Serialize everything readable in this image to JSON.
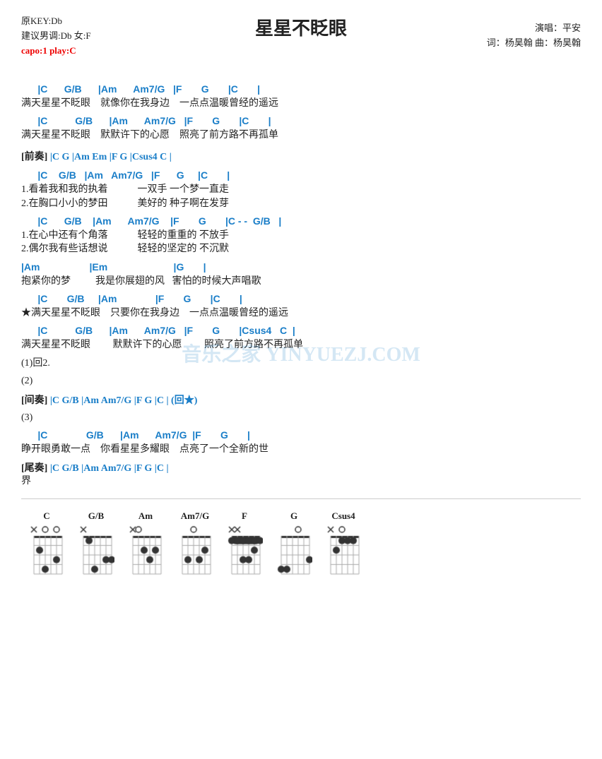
{
  "title": "星星不眨眼",
  "meta": {
    "key": "原KEY:Db",
    "suggest": "建议男调:Db 女:F",
    "capo": "capo:1 play:C",
    "performer": "演唱：平安",
    "lyricist": "词：杨昊翰  曲：杨昊翰"
  },
  "sections": [
    {
      "id": "intro-chords-1",
      "type": "chord",
      "text": "      |C      G/B      |Am      Am7/G   |F       G       |C       |"
    },
    {
      "id": "intro-lyric-1",
      "type": "lyric",
      "text": "满天星星不眨眼    就像你在我身边    一点点温暖曾经的遥远"
    },
    {
      "id": "intro-chords-2",
      "type": "chord",
      "text": "      |C          G/B      |Am      Am7/G   |F       G       |C       |"
    },
    {
      "id": "intro-lyric-2",
      "type": "lyric",
      "text": "满天星星不眨眼    默默许下的心愿    照亮了前方路不再孤单"
    },
    {
      "id": "prelude-label",
      "type": "label",
      "text": "[前奏] |C  G  |Am  Em  |F  G  |Csus4  C  |"
    },
    {
      "id": "verse-chords-1",
      "type": "chord",
      "text": "      |C    G/B   |Am   Am7/G   |F      G     |C       |"
    },
    {
      "id": "verse-lyric-1a",
      "type": "lyric",
      "text": "1.看着我和我的执着            一双手 一个梦一直走"
    },
    {
      "id": "verse-lyric-1b",
      "type": "lyric",
      "text": "2.在胸口小小的梦田            美好的 种子啊在发芽"
    },
    {
      "id": "verse-chords-2",
      "type": "chord",
      "text": "      |C      G/B    |Am      Am7/G    |F       G       |C - -  G/B   |"
    },
    {
      "id": "verse-lyric-2a",
      "type": "lyric",
      "text": "1.在心中还有个角落            轻轻的重重的 不放手"
    },
    {
      "id": "verse-lyric-2b",
      "type": "lyric",
      "text": "2.偶尔我有些话想说            轻轻的坚定的 不沉默"
    },
    {
      "id": "am-chords",
      "type": "chord",
      "text": "|Am                  |Em                        |G       |"
    },
    {
      "id": "am-lyric",
      "type": "lyric",
      "text": "抱紧你的梦          我是你展翅的风   害怕的时候大声唱歌"
    },
    {
      "id": "chorus-chords-1",
      "type": "chord",
      "text": "      |C       G/B     |Am              |F       G       |C       |"
    },
    {
      "id": "chorus-lyric-1",
      "type": "lyric",
      "text": "★满天星星不眨眼    只要你在我身边    一点点温暖曾经的遥远"
    },
    {
      "id": "chorus-chords-2",
      "type": "chord",
      "text": "      |C          G/B      |Am      Am7/G   |F       G       |Csus4   C  |"
    },
    {
      "id": "chorus-lyric-2",
      "type": "lyric",
      "text": "满天星星不眨眼         默默许下的心愿         照亮了前方路不再孤单"
    },
    {
      "id": "repeat-1",
      "type": "lyric",
      "text": "(1)回2."
    },
    {
      "id": "repeat-2",
      "type": "lyric",
      "text": "(2)"
    },
    {
      "id": "interlude-label",
      "type": "label",
      "text": "[间奏] |C  G/B  |Am  Am7/G  |F  G  |C  |   (回★)"
    },
    {
      "id": "repeat-3",
      "type": "lyric",
      "text": "(3)"
    },
    {
      "id": "bridge-chords",
      "type": "chord",
      "text": "      |C              G/B      |Am      Am7/G  |F       G       |"
    },
    {
      "id": "bridge-lyric",
      "type": "lyric",
      "text": "睁开眼勇敢一点    你看星星多耀眼    点亮了一个全新的世"
    },
    {
      "id": "outro-label",
      "type": "label",
      "text": "[尾奏] |C  G/B  |Am  Am7/G  |F  G  |C  |"
    },
    {
      "id": "outro-lyric",
      "type": "lyric",
      "text": "界"
    }
  ],
  "chords": [
    {
      "name": "C",
      "open": [
        "x",
        "",
        "o",
        "",
        "o",
        ""
      ],
      "frets": [
        [
          0,
          0,
          0,
          0,
          0,
          0
        ],
        [
          0,
          0,
          1,
          0,
          0,
          0
        ],
        [
          0,
          1,
          0,
          0,
          0,
          0
        ],
        [
          0,
          0,
          0,
          0,
          1,
          0
        ]
      ],
      "barre": null
    },
    {
      "name": "G/B",
      "open": [
        "x",
        "",
        "",
        "",
        "",
        ""
      ],
      "frets": [
        [
          0,
          0,
          0,
          0,
          0,
          0
        ],
        [
          0,
          1,
          0,
          0,
          0,
          0
        ],
        [
          0,
          0,
          0,
          0,
          1,
          1
        ],
        [
          0,
          0,
          1,
          0,
          0,
          0
        ]
      ],
      "barre": null
    },
    {
      "name": "Am",
      "open": [
        "x",
        "o",
        "",
        "",
        "",
        ""
      ],
      "frets": [
        [
          0,
          0,
          0,
          0,
          0,
          0
        ],
        [
          0,
          0,
          1,
          0,
          1,
          0
        ],
        [
          0,
          0,
          0,
          1,
          0,
          0
        ],
        [
          0,
          0,
          0,
          0,
          0,
          0
        ]
      ],
      "barre": null
    },
    {
      "name": "Am7/G",
      "open": [
        "",
        "",
        "o",
        "",
        "",
        ""
      ],
      "frets": [
        [
          0,
          0,
          0,
          0,
          0,
          0
        ],
        [
          0,
          0,
          0,
          0,
          1,
          0
        ],
        [
          0,
          1,
          0,
          1,
          0,
          0
        ],
        [
          0,
          0,
          0,
          0,
          0,
          0
        ]
      ],
      "barre": null
    },
    {
      "name": "F",
      "open": [
        "x",
        "x",
        "",
        "",
        "",
        ""
      ],
      "frets": [
        [
          1,
          1,
          1,
          1,
          1,
          1
        ],
        [
          0,
          0,
          0,
          0,
          1,
          0
        ],
        [
          0,
          0,
          1,
          1,
          0,
          0
        ],
        [
          0,
          0,
          0,
          0,
          0,
          0
        ]
      ],
      "barre": 1
    },
    {
      "name": "G",
      "open": [
        "",
        "",
        "",
        "o",
        "",
        ""
      ],
      "frets": [
        [
          0,
          0,
          0,
          0,
          0,
          0
        ],
        [
          0,
          0,
          0,
          0,
          1,
          0
        ],
        [
          0,
          0,
          0,
          0,
          0,
          1
        ],
        [
          1,
          1,
          0,
          0,
          0,
          0
        ]
      ],
      "barre": null
    },
    {
      "name": "Csus4",
      "open": [
        "x",
        "",
        "o",
        "",
        "",
        ""
      ],
      "frets": [
        [
          0,
          0,
          0,
          0,
          0,
          0
        ],
        [
          0,
          0,
          1,
          1,
          1,
          0
        ],
        [
          0,
          1,
          0,
          0,
          0,
          0
        ],
        [
          0,
          0,
          0,
          0,
          0,
          0
        ]
      ],
      "barre": null
    }
  ]
}
